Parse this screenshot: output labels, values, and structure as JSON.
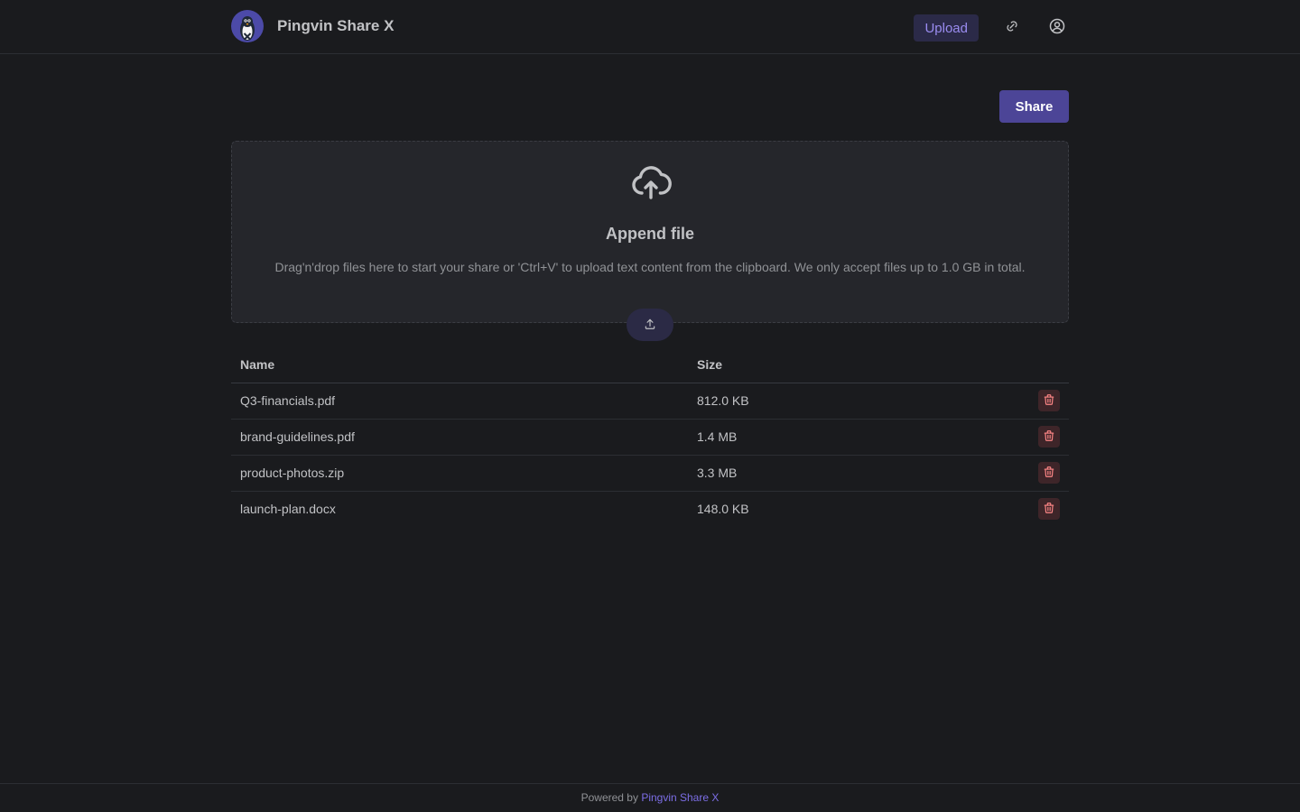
{
  "header": {
    "app_name": "Pingvin Share X",
    "nav_upload_label": "Upload",
    "link_icon": "link-icon",
    "account_icon": "user-circle-icon"
  },
  "share_button_label": "Share",
  "dropzone": {
    "icon": "cloud-upload-icon",
    "title": "Append file",
    "description": "Drag'n'drop files here to start your share or 'Ctrl+V' to upload text content from the clipboard. We only accept files up to 1.0 GB in total.",
    "upload_button_icon": "upload-icon"
  },
  "table": {
    "headers": {
      "name": "Name",
      "size": "Size"
    },
    "rows": [
      {
        "name": "Q3-financials.pdf",
        "size": "812.0 KB"
      },
      {
        "name": "brand-guidelines.pdf",
        "size": "1.4 MB"
      },
      {
        "name": "product-photos.zip",
        "size": "3.3 MB"
      },
      {
        "name": "launch-plan.docx",
        "size": "148.0 KB"
      }
    ],
    "delete_icon": "trash-icon"
  },
  "footer": {
    "prefix": "Powered by",
    "link_label": "Pingvin Share X"
  },
  "colors": {
    "background": "#1a1b1e",
    "primary": "#4c4597",
    "accent_text": "#9a8cf0",
    "danger": "#e03131"
  }
}
